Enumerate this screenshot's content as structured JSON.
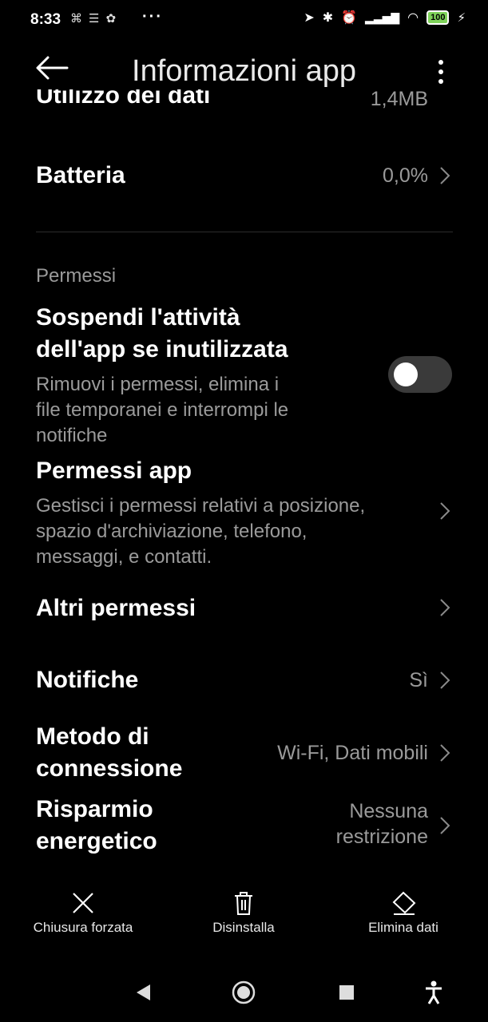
{
  "status_bar": {
    "time": "8:33",
    "dots": "···",
    "battery": "100"
  },
  "header": {
    "title": "Informazioni app"
  },
  "rows": {
    "data_usage": {
      "label": "Utilizzo dei dati",
      "value": "1,4MB"
    },
    "battery": {
      "label": "Batteria",
      "value": "0,0%"
    },
    "permissions_section": {
      "label": "Permessi"
    },
    "suspend": {
      "label_line1": "Sospendi l'attività",
      "label_line2": "dell'app se inutilizzata",
      "desc_line1": "Rimuovi i permessi, elimina i",
      "desc_line2": "file temporanei e interrompi le",
      "desc_line3": "notifiche",
      "enabled": false
    },
    "app_permissions": {
      "label": "Permessi app",
      "desc_line1": "Gestisci i permessi relativi a posizione,",
      "desc_line2": "spazio d'archiviazione, telefono,",
      "desc_line3": "messaggi, e contatti."
    },
    "other_permissions": {
      "label": "Altri permessi"
    },
    "notifications": {
      "label": "Notifiche",
      "value": "Sì"
    },
    "connection": {
      "label_line1": "Metodo di",
      "label_line2": "connessione",
      "value": "Wi-Fi, Dati mobili"
    },
    "power_saving": {
      "label_line1": "Risparmio",
      "label_line2": "energetico",
      "value_line1": "Nessuna",
      "value_line2": "restrizione"
    }
  },
  "bottom_actions": {
    "force_stop": "Chiusura forzata",
    "uninstall": "Disinstalla",
    "clear_data": "Elimina dati"
  },
  "colors": {
    "background": "#000000",
    "primary_text": "#ffffff",
    "secondary_text": "#9a9a9a",
    "toggle_track": "#3a3a3a"
  }
}
